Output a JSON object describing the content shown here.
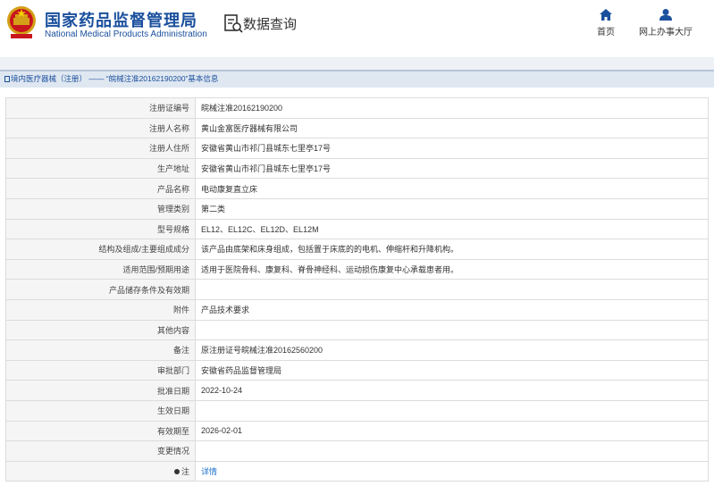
{
  "header": {
    "site_title": "国家药品监督管理局",
    "site_subtitle": "National Medical Products Administration",
    "query_title": "数据查询",
    "nav": [
      {
        "label": "首页"
      },
      {
        "label": "网上办事大厅"
      }
    ]
  },
  "breadcrumb": {
    "category": "境内医疗器械（注册）",
    "separator": " —— ",
    "item": "“皖械注准20162190200”基本信息"
  },
  "details": [
    {
      "label": "注册证编号",
      "value": "皖械注准20162190200"
    },
    {
      "label": "注册人名称",
      "value": "黄山金富医疗器械有限公司"
    },
    {
      "label": "注册人住所",
      "value": "安徽省黄山市祁门县城东七里亭17号"
    },
    {
      "label": "生产地址",
      "value": "安徽省黄山市祁门县城东七里亭17号"
    },
    {
      "label": "产品名称",
      "value": "电动康复直立床"
    },
    {
      "label": "管理类别",
      "value": "第二类"
    },
    {
      "label": "型号规格",
      "value": "EL12、EL12C、EL12D、EL12M"
    },
    {
      "label": "结构及组成/主要组成成分",
      "value": "该产品由底架和床身组成，包括置于床底的的电机、伸缩杆和升降机构。"
    },
    {
      "label": "适用范围/预期用途",
      "value": "适用于医院骨科、康复科、脊骨神经科、运动损伤康复中心承载患者用。"
    },
    {
      "label": "产品储存条件及有效期",
      "value": ""
    },
    {
      "label": "附件",
      "value": "产品技术要求"
    },
    {
      "label": "其他内容",
      "value": ""
    },
    {
      "label": "备注",
      "value": "原注册证号皖械注准20162560200"
    },
    {
      "label": "审批部门",
      "value": "安徽省药品监督管理局"
    },
    {
      "label": "批准日期",
      "value": "2022-10-24"
    },
    {
      "label": "生效日期",
      "value": ""
    },
    {
      "label": "有效期至",
      "value": "2026-02-01"
    },
    {
      "label": "变更情况",
      "value": ""
    },
    {
      "label": "注",
      "value": "详情",
      "is_link": true
    }
  ]
}
